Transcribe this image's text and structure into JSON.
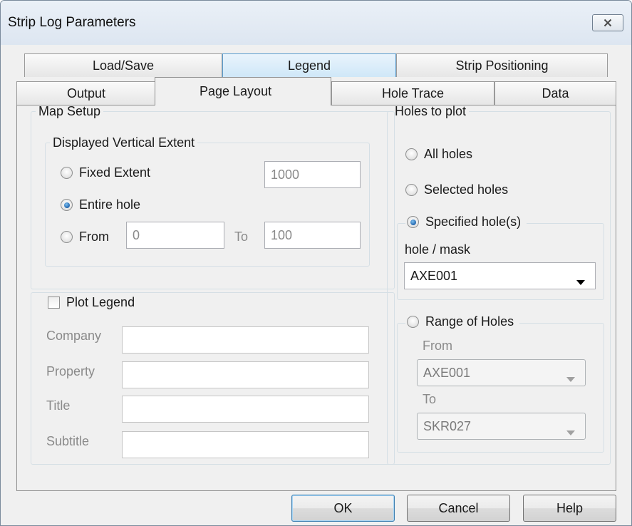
{
  "window": {
    "title": "Strip Log Parameters"
  },
  "tabs": {
    "row_back": [
      {
        "label": "Load/Save"
      },
      {
        "label": "Legend"
      },
      {
        "label": "Strip Positioning"
      }
    ],
    "row_front": [
      {
        "label": "Output"
      },
      {
        "label": "Page Layout"
      },
      {
        "label": "Hole Trace"
      },
      {
        "label": "Data"
      }
    ]
  },
  "map_setup": {
    "title": "Map Setup",
    "vertical_extent": {
      "title": "Displayed Vertical Extent",
      "options": [
        {
          "label": "Fixed Extent",
          "selected": false
        },
        {
          "label": "Entire hole",
          "selected": true
        },
        {
          "label": "From",
          "selected": false
        }
      ],
      "fixed_value": "1000",
      "from_value": "0",
      "to_label": "To",
      "to_value": "100"
    }
  },
  "plot_legend": {
    "label": "Plot Legend",
    "checked": false,
    "fields": [
      {
        "label": "Company",
        "value": ""
      },
      {
        "label": "Property",
        "value": ""
      },
      {
        "label": "Title",
        "value": ""
      },
      {
        "label": "Subtitle",
        "value": ""
      }
    ]
  },
  "holes": {
    "title": "Holes to plot",
    "all_holes": "All holes",
    "selected_holes": "Selected holes",
    "specified": {
      "label": "Specified hole(s)",
      "selected": true,
      "mask_label": "hole / mask",
      "mask_value": "AXE001"
    },
    "range": {
      "label": "Range of Holes",
      "selected": false,
      "from_label": "From",
      "from_value": "AXE001",
      "to_label": "To",
      "to_value": "SKR027"
    }
  },
  "buttons": {
    "ok": "OK",
    "cancel": "Cancel",
    "help": "Help"
  },
  "colors": {
    "accent_tab": "#cfe7f8",
    "radio_dot": "#1a5ea8",
    "disabled_text": "#8a8a8a"
  },
  "icons": {
    "close": "close-icon",
    "dropdown": "chevron-down-icon"
  }
}
